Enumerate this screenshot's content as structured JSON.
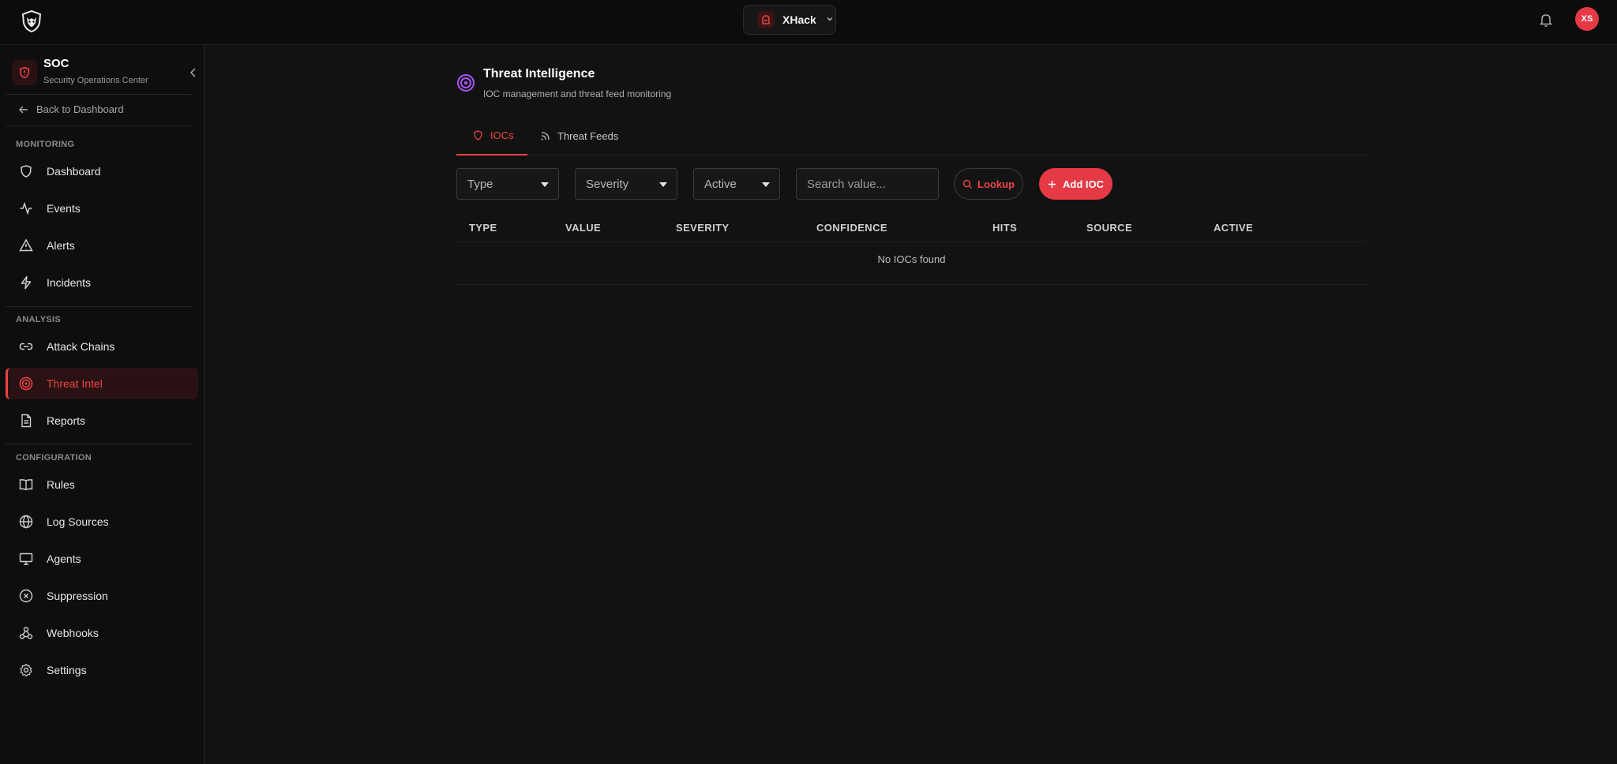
{
  "topbar": {
    "workspace_name": "XHack",
    "avatar_initials": "XS",
    "brand_color": "#e63946"
  },
  "sidebar": {
    "title": "SOC",
    "subtitle": "Security Operations Center",
    "back_label": "Back to Dashboard",
    "sections": {
      "monitoring": "MONITORING",
      "analysis": "ANALYSIS",
      "configuration": "CONFIGURATION"
    },
    "items": [
      {
        "label": "Dashboard",
        "icon": "shield-icon"
      },
      {
        "label": "Events",
        "icon": "activity-icon"
      },
      {
        "label": "Alerts",
        "icon": "warning-triangle-icon"
      },
      {
        "label": "Incidents",
        "icon": "lightning-icon"
      },
      {
        "label": "Attack Chains",
        "icon": "link-icon"
      },
      {
        "label": "Threat Intel",
        "icon": "target-icon",
        "active": true
      },
      {
        "label": "Reports",
        "icon": "document-icon"
      },
      {
        "label": "Rules",
        "icon": "book-icon"
      },
      {
        "label": "Log Sources",
        "icon": "globe-icon"
      },
      {
        "label": "Agents",
        "icon": "monitor-icon"
      },
      {
        "label": "Suppression",
        "icon": "circle-x-icon"
      },
      {
        "label": "Webhooks",
        "icon": "webhook-icon"
      },
      {
        "label": "Settings",
        "icon": "gear-icon"
      }
    ]
  },
  "page": {
    "title": "Threat Intelligence",
    "subtitle": "IOC management and threat feed monitoring"
  },
  "tabs": [
    {
      "label": "IOCs",
      "active": true
    },
    {
      "label": "Threat Feeds",
      "active": false
    }
  ],
  "filters": {
    "type": "Type",
    "severity": "Severity",
    "active": "Active",
    "search_placeholder": "Search value...",
    "lookup_label": "Lookup",
    "add_label": "Add IOC"
  },
  "table": {
    "columns": [
      "TYPE",
      "VALUE",
      "SEVERITY",
      "CONFIDENCE",
      "HITS",
      "SOURCE",
      "ACTIVE"
    ],
    "rows": [],
    "empty_message": "No IOCs found"
  }
}
